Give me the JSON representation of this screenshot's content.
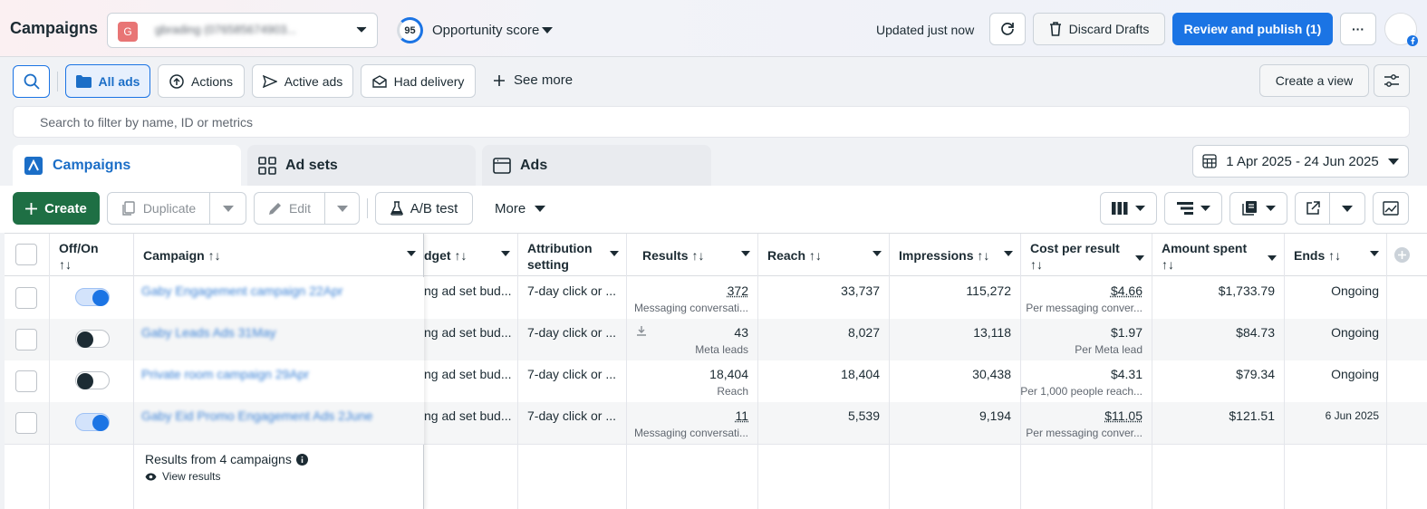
{
  "header": {
    "title": "Campaigns",
    "account_initial": "G",
    "account_name": "gbrading (076585674903...",
    "opportunity_score": "95",
    "opportunity_label": "Opportunity score",
    "updated": "Updated just now",
    "discard_label": "Discard Drafts",
    "publish_label": "Review and publish (1)",
    "more_label": "···"
  },
  "filters": {
    "all_ads": "All ads",
    "actions": "Actions",
    "active_ads": "Active ads",
    "had_delivery": "Had delivery",
    "see_more": "See more",
    "create_view": "Create a view",
    "search_placeholder": "Search to filter by name, ID or metrics"
  },
  "tabs": {
    "campaigns": "Campaigns",
    "ad_sets": "Ad sets",
    "ads": "Ads"
  },
  "date_range": "1 Apr 2025 - 24 Jun 2025",
  "toolbar": {
    "create": "Create",
    "duplicate": "Duplicate",
    "edit": "Edit",
    "ab_test": "A/B test",
    "more": "More"
  },
  "table": {
    "headers": {
      "off_on": "Off/On",
      "sort": "↑↓",
      "campaign": "Campaign ↑↓",
      "budget": "dget ↑↓",
      "attribution1": "Attribution",
      "attribution2": "setting",
      "results": "Results ↑↓",
      "reach": "Reach ↑↓",
      "impressions": "Impressions ↑↓",
      "cpr": "Cost per result",
      "amount": "Amount spent",
      "ends": "Ends ↑↓"
    },
    "rows": [
      {
        "name": "Gaby Engagement campaign 22Apr",
        "on": true,
        "budget": "ng ad set bud...",
        "attribution": "7-day click or ...",
        "results": "372",
        "results_sub": "Messaging conversati...",
        "reach": "33,737",
        "impressions": "115,272",
        "cpr": "$4.66",
        "cpr_sub": "Per messaging conver...",
        "amount": "$1,733.79",
        "ends": "Ongoing"
      },
      {
        "name": "Gaby Leads Ads 31May",
        "on": false,
        "budget": "ng ad set bud...",
        "attribution": "7-day click or ...",
        "results": "43",
        "results_sub": "Meta leads",
        "reach": "8,027",
        "impressions": "13,118",
        "cpr": "$1.97",
        "cpr_sub": "Per Meta lead",
        "amount": "$84.73",
        "ends": "Ongoing"
      },
      {
        "name": "Private room campaign 29Apr",
        "on": false,
        "budget": "ng ad set bud...",
        "attribution": "7-day click or ...",
        "results": "18,404",
        "results_sub": "Reach",
        "reach": "18,404",
        "impressions": "30,438",
        "cpr": "$4.31",
        "cpr_sub": "Per 1,000 people reach...",
        "amount": "$79.34",
        "ends": "Ongoing"
      },
      {
        "name": "Gaby Eid Promo Engagement Ads 2June",
        "on": true,
        "budget": "ng ad set bud...",
        "attribution": "7-day click or ...",
        "results": "11",
        "results_sub": "Messaging conversati...",
        "reach": "5,539",
        "impressions": "9,194",
        "cpr": "$11.05",
        "cpr_sub": "Per messaging conver...",
        "amount": "$121.51",
        "ends": "6 Jun 2025"
      }
    ],
    "footer_results": "Results from 4 campaigns",
    "footer_view": "View results"
  }
}
